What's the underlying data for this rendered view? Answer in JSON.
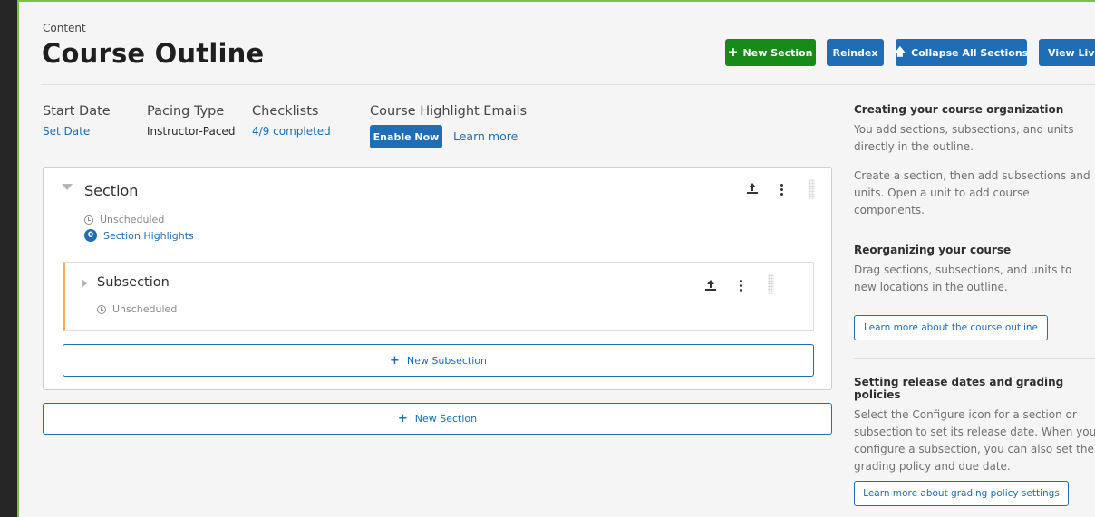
{
  "header": {
    "eyebrow": "Content",
    "title": "Course Outline",
    "buttons": {
      "new_section": "New Section",
      "reindex": "Reindex",
      "collapse_all": "Collapse All Sections",
      "view_live": "View Live"
    }
  },
  "course_meta": {
    "start_date": {
      "label": "Start Date",
      "value": "Set Date"
    },
    "pacing_type": {
      "label": "Pacing Type",
      "value": "Instructor-Paced"
    },
    "checklists": {
      "label": "Checklists",
      "value": "4/9 completed"
    },
    "highlight_emails": {
      "label": "Course Highlight Emails",
      "enable_label": "Enable Now",
      "learn_more": "Learn more"
    }
  },
  "outline": {
    "section": {
      "title": "Section",
      "status": "Unscheduled",
      "highlights_count": "0",
      "highlights_label": "Section Highlights"
    },
    "subsection": {
      "title": "Subsection",
      "status": "Unscheduled"
    },
    "new_subsection_label": "New Subsection",
    "new_section_label": "New Section"
  },
  "help_sidebar": {
    "blocks": [
      {
        "title": "Creating your course organization",
        "paragraphs": [
          "You add sections, subsections, and units directly in the outline.",
          "Create a section, then add subsections and units. Open a unit to add course components."
        ]
      },
      {
        "title": "Reorganizing your course",
        "paragraphs": [
          "Drag sections, subsections, and units to new locations in the outline."
        ],
        "button": "Learn more about the course outline"
      },
      {
        "title": "Setting release dates and grading policies",
        "paragraphs": [
          "Select the Configure icon for a section or subsection to set its release date. When you configure a subsection, you can also set the grading policy and due date."
        ],
        "button": "Learn more about grading policy settings"
      }
    ]
  },
  "colors": {
    "primary": "#1f6db5",
    "success": "#178b17",
    "subsection_accent": "#f5a952",
    "frame_border": "#7bc142"
  },
  "icons": [
    "plus-icon",
    "arrow-up-icon",
    "clock-icon",
    "publish-icon",
    "kebab-menu-icon",
    "drag-handle-icon",
    "caret-down-icon",
    "caret-right-icon"
  ]
}
